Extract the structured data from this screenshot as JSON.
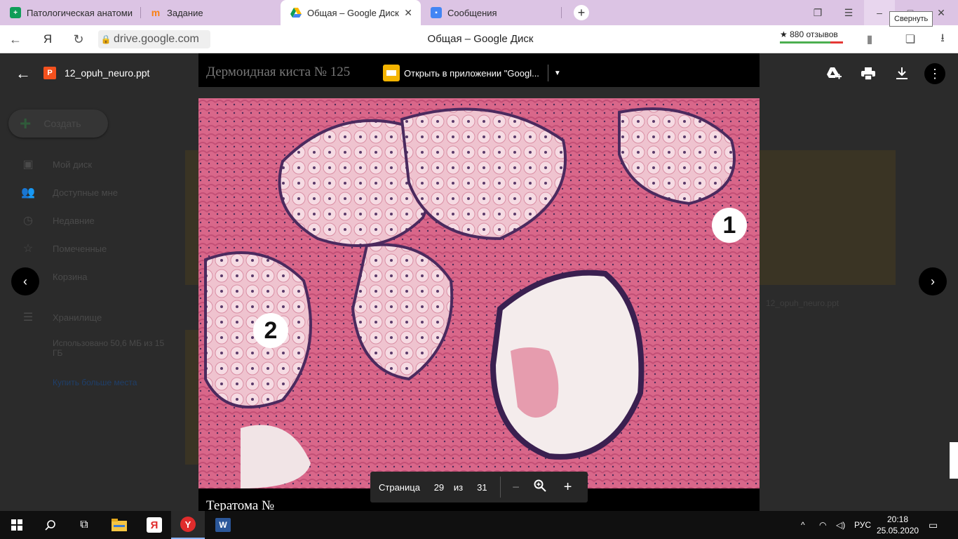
{
  "browser": {
    "tabs": [
      {
        "label": "Патологическая анатоми",
        "icon": "sheets-icon",
        "color": "#0f9d58",
        "active": false
      },
      {
        "label": "Задание",
        "icon": "moodle-icon",
        "color": "#f98012",
        "active": false
      },
      {
        "label": "Общая – Google Диск",
        "icon": "drive-icon",
        "color": "#1a73e8",
        "active": true
      },
      {
        "label": "Сообщения",
        "icon": "messages-icon",
        "color": "#4285f4",
        "active": false
      }
    ],
    "tooltip": "Свернуть",
    "url_text": "drive.google.com",
    "page_title": "Общая – Google Диск",
    "reviews": "★ 880 отзывов"
  },
  "drive": {
    "create_label": "Создать",
    "sidebar": [
      {
        "label": "Мой диск",
        "icon": "my-drive-icon"
      },
      {
        "label": "Доступные мне",
        "icon": "shared-icon"
      },
      {
        "label": "Недавние",
        "icon": "clock-icon"
      },
      {
        "label": "Помеченные",
        "icon": "star-icon"
      },
      {
        "label": "Корзина",
        "icon": "trash-icon"
      }
    ],
    "storage_label": "Хранилище",
    "storage_used": "Использовано 50,6 МБ из 15 ГБ",
    "buy_more": "Купить больше места",
    "thumb_label": "12_opuh_neuro.ppt"
  },
  "viewer": {
    "filename": "12_opuh_neuro.ppt",
    "open_in_app": "Открыть в приложении \"Googl...",
    "slide_title": "Дермоидная киста № 125",
    "next_slide_title": "Тератома №",
    "page": {
      "label": "Страница",
      "current": "29",
      "of": "из",
      "total": "31"
    },
    "markers": [
      "1",
      "2"
    ]
  },
  "taskbar": {
    "lang": "РУС",
    "time": "20:18",
    "date": "25.05.2020"
  }
}
